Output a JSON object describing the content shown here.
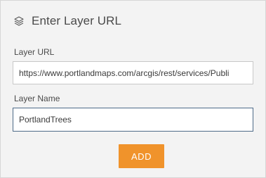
{
  "dialog": {
    "icon": "layers-icon",
    "title": "Enter Layer URL"
  },
  "form": {
    "url_label": "Layer URL",
    "url_value": "https://www.portlandmaps.com/arcgis/rest/services/Publi",
    "name_label": "Layer Name",
    "name_value": "PortlandTrees",
    "add_label": "ADD"
  },
  "colors": {
    "panel_bg": "#f3f3f3",
    "button_accent": "#f0932b",
    "focus_border": "#4d6a88"
  }
}
